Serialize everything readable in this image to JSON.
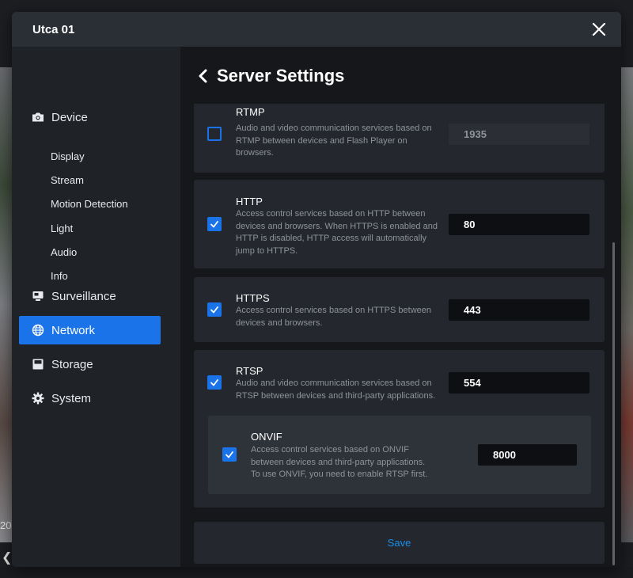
{
  "window": {
    "title": "Utca 01"
  },
  "background": {
    "left_text": "20"
  },
  "sidebar": {
    "device": {
      "label": "Device",
      "icon": "camera-icon",
      "subitems": [
        "Display",
        "Stream",
        "Motion Detection",
        "Light",
        "Audio",
        "Info"
      ]
    },
    "items": [
      {
        "label": "Surveillance",
        "icon": "monitor-icon"
      },
      {
        "label": "Network",
        "icon": "globe-icon",
        "active": true
      },
      {
        "label": "Storage",
        "icon": "storage-icon"
      },
      {
        "label": "System",
        "icon": "gear-icon"
      }
    ]
  },
  "main": {
    "title": "Server Settings",
    "services": [
      {
        "name": "RTMP",
        "description": "Audio and video communication services based on RTMP between devices and Flash Player on browsers.",
        "port": "1935",
        "enabled": false
      },
      {
        "name": "HTTP",
        "description": "Access control services based on HTTP between devices and browsers. When HTTPS is enabled and HTTP is disabled, HTTP access will automatically jump to HTTPS.",
        "port": "80",
        "enabled": true
      },
      {
        "name": "HTTPS",
        "description": "Access control services based on HTTPS between devices and browsers.",
        "port": "443",
        "enabled": true
      },
      {
        "name": "RTSP",
        "description": "Audio and video communication services based on RTSP between devices and third-party applications.",
        "port": "554",
        "enabled": true
      },
      {
        "name": "ONVIF",
        "description": "Access control services based on ONVIF between devices and third-party applications. To use ONVIF, you need to enable RTSP first.",
        "port": "8000",
        "enabled": true
      }
    ],
    "save_label": "Save"
  },
  "colors": {
    "accent": "#1a73e8",
    "save_link": "#1a8fe8"
  }
}
